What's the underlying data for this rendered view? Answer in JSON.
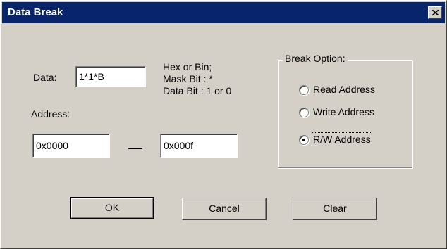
{
  "window": {
    "title": "Data Break",
    "close_icon": "close-icon"
  },
  "data_section": {
    "label": "Data:",
    "value": "1*1*B",
    "help": [
      "Hex or Bin;",
      "Mask Bit :  *",
      "Data Bit :   1 or 0"
    ]
  },
  "address_section": {
    "label": "Address:",
    "start_value": "0x0000",
    "end_value": "0x000f"
  },
  "break_option": {
    "title": "Break Option:",
    "selected": "R/W Address",
    "options": [
      {
        "label": "Read Address",
        "checked": false
      },
      {
        "label": "Write Address",
        "checked": false
      },
      {
        "label": "R/W Address",
        "checked": true
      }
    ]
  },
  "buttons": {
    "ok": "OK",
    "cancel": "Cancel",
    "clear": "Clear"
  },
  "colors": {
    "face": "#d4d0c8",
    "titlebar": "#08246b"
  }
}
